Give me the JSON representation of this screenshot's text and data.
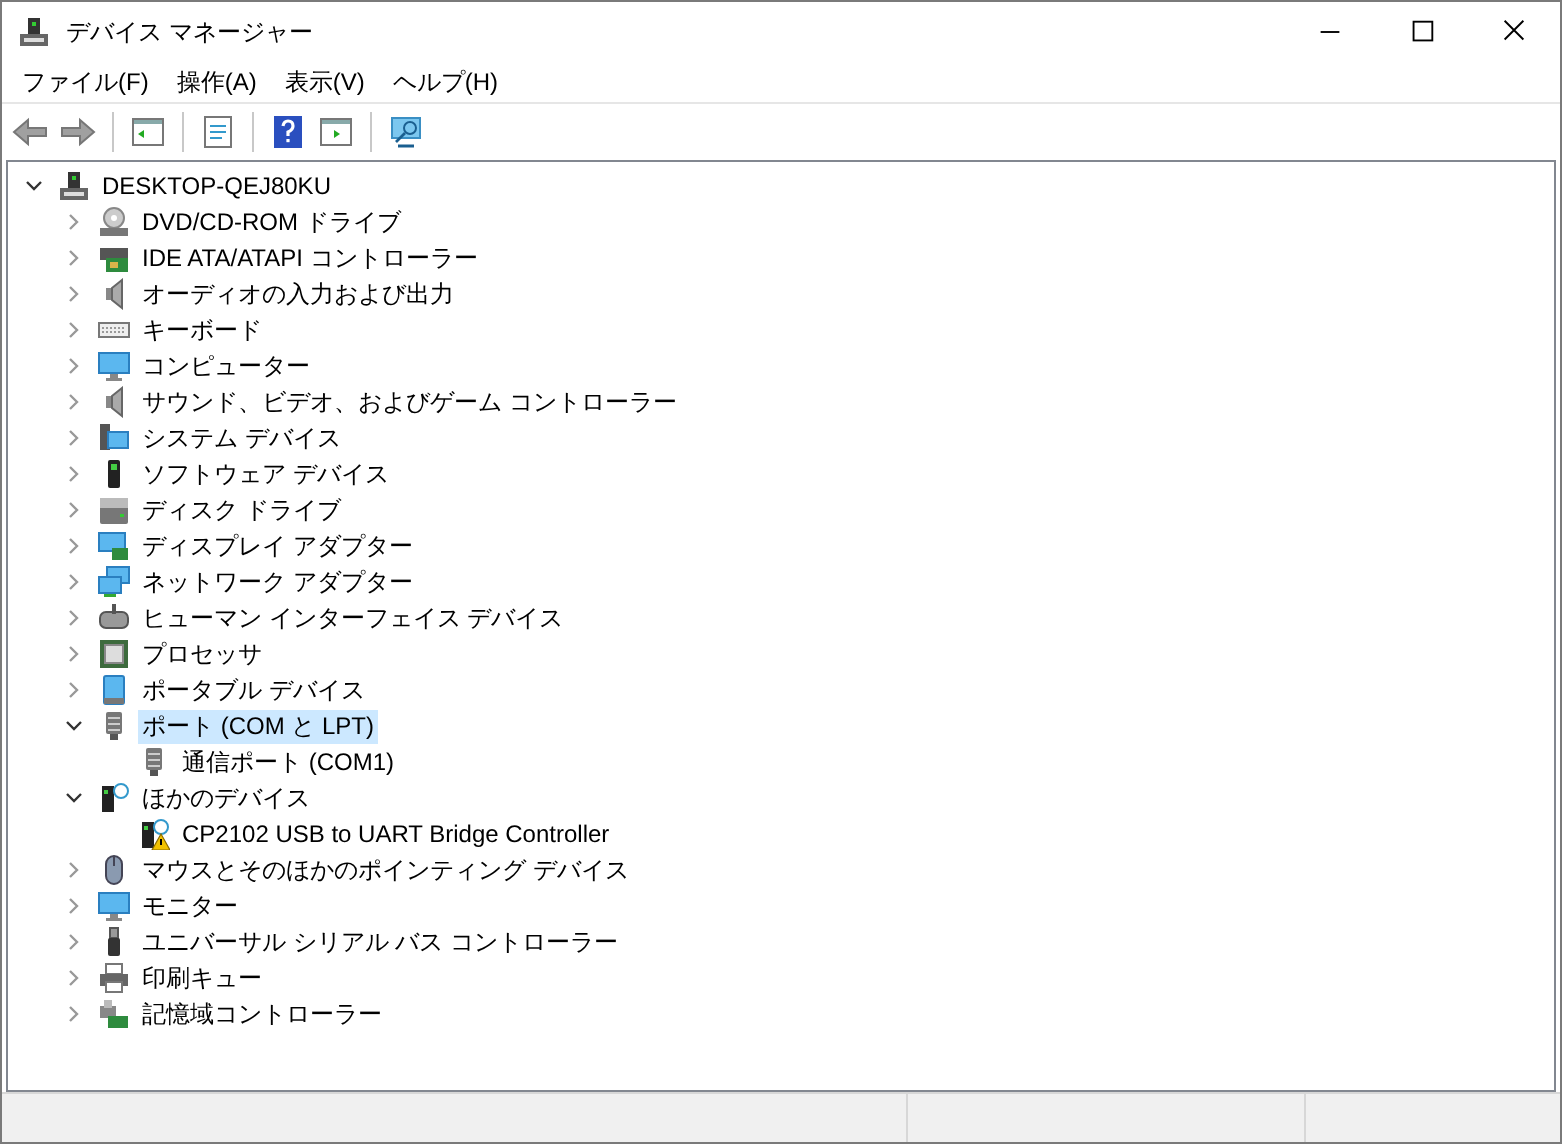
{
  "window": {
    "title": "デバイス マネージャー"
  },
  "menu": [
    "ファイル(F)",
    "操作(A)",
    "表示(V)",
    "ヘルプ(H)"
  ],
  "toolbar": {
    "back_disabled": true,
    "forward_disabled": true
  },
  "tree": {
    "label": "DESKTOP-QEJ80KU",
    "expanded": true,
    "selected": false,
    "children": [
      {
        "label": "DVD/CD-ROM ドライブ",
        "expanded": false,
        "selected": false
      },
      {
        "label": "IDE ATA/ATAPI コントローラー",
        "expanded": false,
        "selected": false
      },
      {
        "label": "オーディオの入力および出力",
        "expanded": false,
        "selected": false
      },
      {
        "label": "キーボード",
        "expanded": false,
        "selected": false
      },
      {
        "label": "コンピューター",
        "expanded": false,
        "selected": false
      },
      {
        "label": "サウンド、ビデオ、およびゲーム コントローラー",
        "expanded": false,
        "selected": false
      },
      {
        "label": "システム デバイス",
        "expanded": false,
        "selected": false
      },
      {
        "label": "ソフトウェア デバイス",
        "expanded": false,
        "selected": false
      },
      {
        "label": "ディスク ドライブ",
        "expanded": false,
        "selected": false
      },
      {
        "label": "ディスプレイ アダプター",
        "expanded": false,
        "selected": false
      },
      {
        "label": "ネットワーク アダプター",
        "expanded": false,
        "selected": false
      },
      {
        "label": "ヒューマン インターフェイス デバイス",
        "expanded": false,
        "selected": false
      },
      {
        "label": "プロセッサ",
        "expanded": false,
        "selected": false
      },
      {
        "label": "ポータブル デバイス",
        "expanded": false,
        "selected": false
      },
      {
        "label": "ポート (COM と LPT)",
        "expanded": true,
        "selected": true,
        "children": [
          {
            "label": "通信ポート (COM1)",
            "selected": false,
            "warning": false
          }
        ]
      },
      {
        "label": "ほかのデバイス",
        "expanded": true,
        "selected": false,
        "children": [
          {
            "label": "CP2102 USB to UART Bridge Controller",
            "selected": false,
            "warning": true
          }
        ]
      },
      {
        "label": "マウスとそのほかのポインティング デバイス",
        "expanded": false,
        "selected": false
      },
      {
        "label": "モニター",
        "expanded": false,
        "selected": false
      },
      {
        "label": "ユニバーサル シリアル バス コントローラー",
        "expanded": false,
        "selected": false
      },
      {
        "label": "印刷キュー",
        "expanded": false,
        "selected": false
      },
      {
        "label": "記憶域コントローラー",
        "expanded": false,
        "selected": false
      }
    ]
  }
}
